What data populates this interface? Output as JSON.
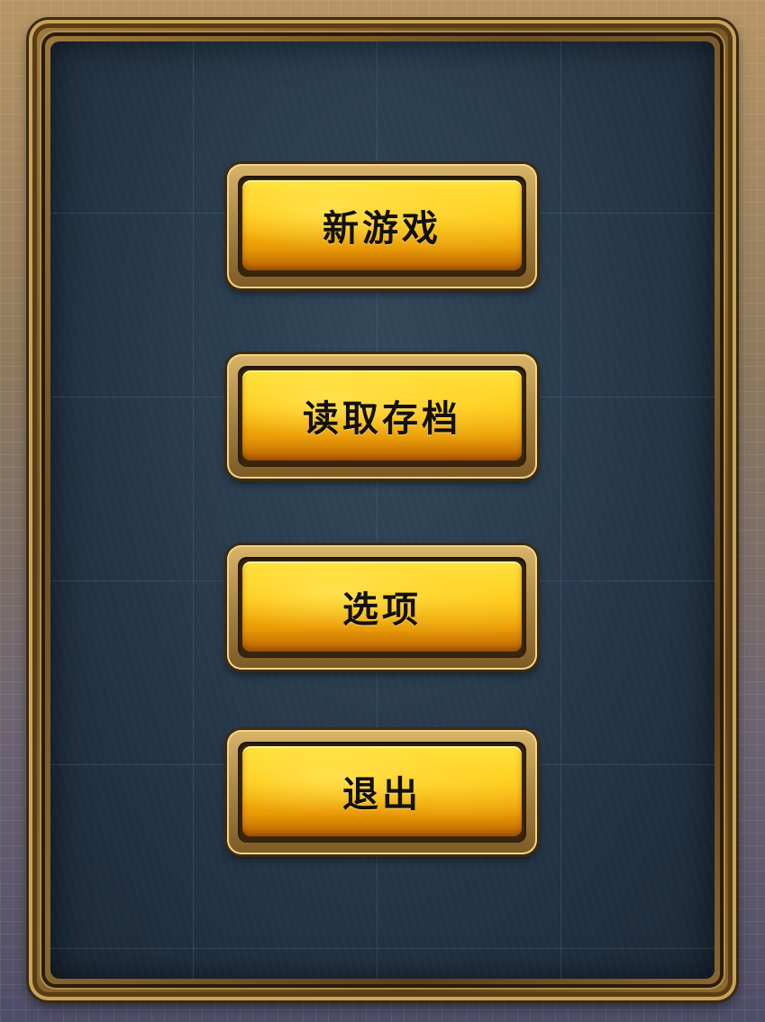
{
  "main_menu": {
    "items": [
      {
        "label": "新游戏"
      },
      {
        "label": "读取存档"
      },
      {
        "label": "选项"
      },
      {
        "label": "退出"
      }
    ]
  },
  "colors": {
    "panel": "#283a4c",
    "frame": "#8a6830",
    "button_face": "#ffc70e",
    "button_text": "#141008"
  }
}
